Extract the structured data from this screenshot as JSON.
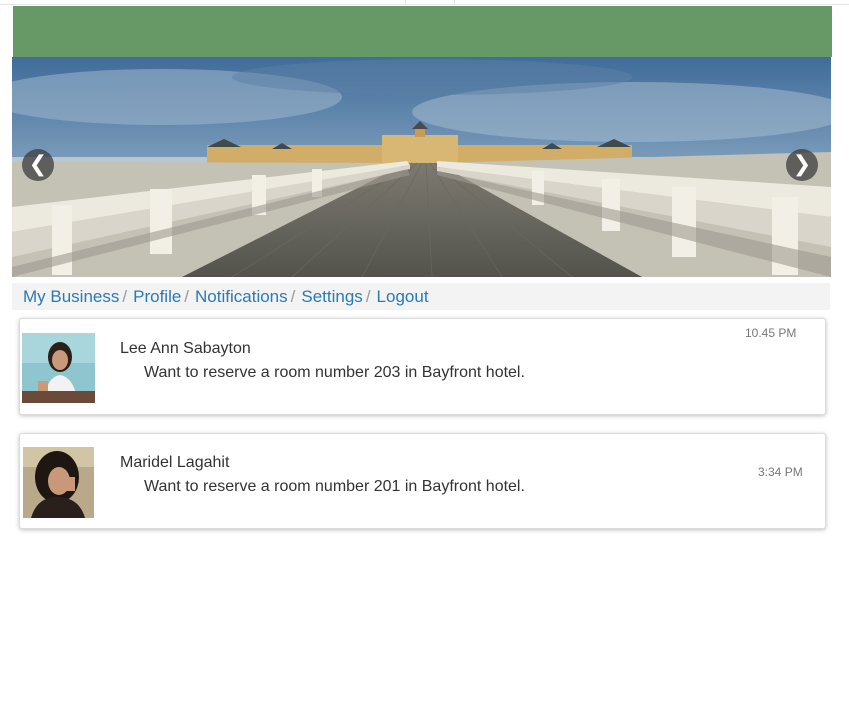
{
  "carousel": {
    "prev_glyph": "❮",
    "next_glyph": "❯",
    "prev_icon": "chevron-left-icon",
    "next_icon": "chevron-right-icon"
  },
  "nav": {
    "items": [
      {
        "label": "My Business"
      },
      {
        "label": "Profile"
      },
      {
        "label": "Notifications"
      },
      {
        "label": "Settings"
      },
      {
        "label": "Logout"
      }
    ],
    "separator": "/"
  },
  "notifications": [
    {
      "name": "Lee Ann Sabayton",
      "message": "Want to reserve a room number 203 in Bayfront hotel.",
      "time": "10.45 PM"
    },
    {
      "name": "Maridel Lagahit",
      "message": "Want to reserve a room number 201 in Bayfront hotel.",
      "time": "3:34 PM"
    }
  ],
  "colors": {
    "header": "#679966",
    "link": "#2a7ab8"
  }
}
